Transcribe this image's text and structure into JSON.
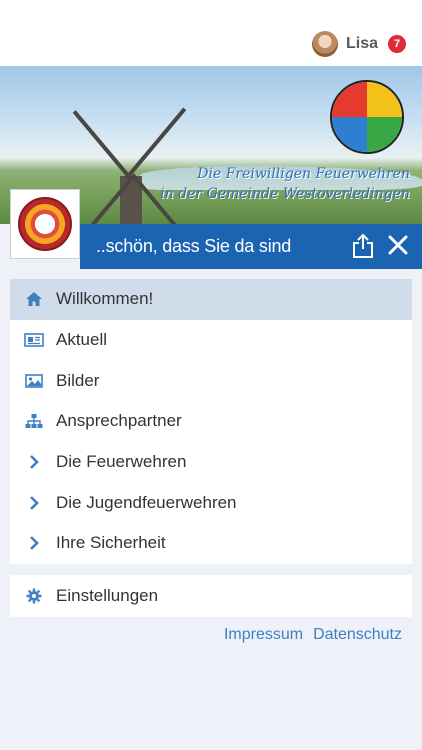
{
  "user": {
    "name": "Lisa",
    "notification_count": "7"
  },
  "banner": {
    "line1": "Die Freiwilligen Feuerwehren",
    "line2": "in der Gemeinde Westoverledingen",
    "welcome": "..schön, dass Sie da sind"
  },
  "menu": {
    "items": [
      {
        "label": "Willkommen!",
        "icon": "home-icon"
      },
      {
        "label": "Aktuell",
        "icon": "newspaper-icon"
      },
      {
        "label": "Bilder",
        "icon": "image-icon"
      },
      {
        "label": "Ansprechpartner",
        "icon": "sitemap-icon"
      },
      {
        "label": "Die Feuerwehren",
        "icon": "chevron-right-icon"
      },
      {
        "label": "Die Jugendfeuerwehren",
        "icon": "chevron-right-icon"
      },
      {
        "label": "Ihre Sicherheit",
        "icon": "chevron-right-icon"
      }
    ],
    "settings_label": "Einstellungen"
  },
  "footer": {
    "impressum": "Impressum",
    "datenschutz": "Datenschutz"
  },
  "colors": {
    "accent": "#1a64b2",
    "active_bg": "#d1dcea",
    "icon": "#3f7fc3",
    "badge": "#e02b36"
  }
}
